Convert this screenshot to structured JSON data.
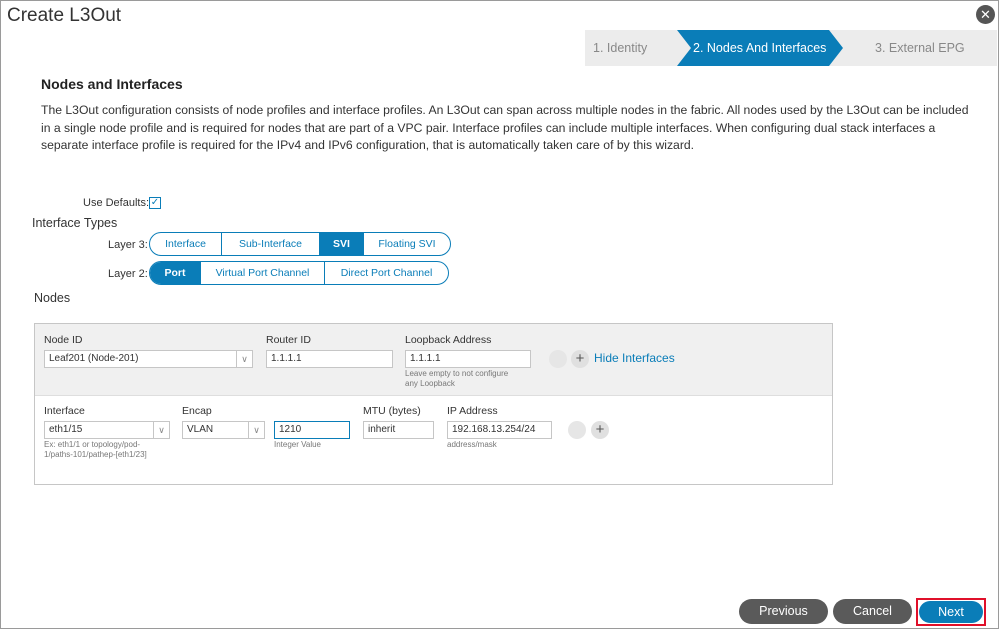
{
  "window": {
    "title": "Create L3Out"
  },
  "wizard": {
    "steps": [
      {
        "label": "1. Identity"
      },
      {
        "label": "2. Nodes And Interfaces"
      },
      {
        "label": "3. External EPG"
      }
    ],
    "active_step": 2
  },
  "section": {
    "title": "Nodes and Interfaces",
    "description": "The L3Out configuration consists of node profiles and interface profiles. An L3Out can span across multiple nodes in the fabric. All nodes used by the L3Out can be included in a single node profile and is required for nodes that are part of a VPC pair. Interface profiles can include multiple interfaces. When configuring dual stack interfaces a separate interface profile is required for the IPv4 and IPv6 configuration, that is automatically taken care of by this wizard."
  },
  "use_defaults": {
    "label": "Use Defaults:",
    "checked": true
  },
  "interface_types": {
    "label": "Interface Types",
    "layer3": {
      "label": "Layer 3:",
      "options": [
        "Interface",
        "Sub-Interface",
        "SVI",
        "Floating SVI"
      ],
      "selected": "SVI"
    },
    "layer2": {
      "label": "Layer 2:",
      "options": [
        "Port",
        "Virtual Port Channel",
        "Direct Port Channel"
      ],
      "selected": "Port"
    }
  },
  "nodes": {
    "label": "Nodes",
    "node_id": {
      "label": "Node ID",
      "value": "Leaf201 (Node-201)"
    },
    "router_id": {
      "label": "Router ID",
      "value": "1.1.1.1"
    },
    "loopback": {
      "label": "Loopback Address",
      "value": "1.1.1.1",
      "hint_1": "Leave empty to not configure",
      "hint_2": "any Loopback"
    },
    "hide_interfaces": "Hide Interfaces",
    "interface_row": {
      "interface": {
        "label": "Interface",
        "value": "eth1/15",
        "hint_1": "Ex: eth1/1 or topology/pod-",
        "hint_2": "1/paths-101/pathep-[eth1/23]"
      },
      "encap": {
        "label": "Encap",
        "type": "VLAN",
        "value": "1210",
        "hint": "Integer Value"
      },
      "mtu": {
        "label": "MTU (bytes)",
        "value": "inherit"
      },
      "ip": {
        "label": "IP Address",
        "value": "192.168.13.254/24",
        "hint": "address/mask"
      }
    }
  },
  "footer": {
    "previous": "Previous",
    "cancel": "Cancel",
    "next": "Next"
  },
  "icons": {
    "close": "close-icon",
    "add": "plus-icon",
    "remove": "minus-icon",
    "dropdown": "chevron-down-icon",
    "check": "check-icon"
  },
  "colors": {
    "accent": "#0a7db8",
    "highlight": "#e0102a",
    "button_dark": "#5a5a5a"
  }
}
